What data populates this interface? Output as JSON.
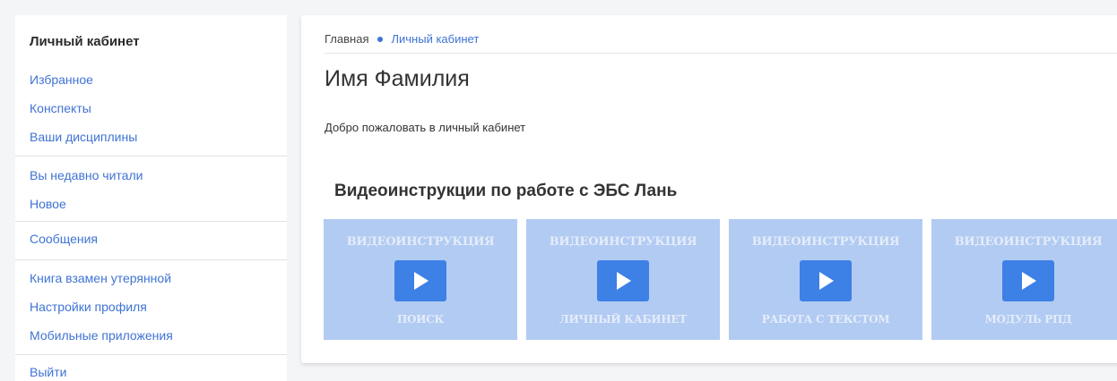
{
  "sidebar": {
    "title": "Личный кабинет",
    "groups": [
      {
        "items": [
          {
            "label": "Избранное"
          },
          {
            "label": "Конспекты"
          },
          {
            "label": "Ваши дисциплины"
          }
        ]
      },
      {
        "items": [
          {
            "label": "Вы недавно читали"
          },
          {
            "label": "Новое"
          }
        ]
      },
      {
        "items": [
          {
            "label": "Сообщения"
          }
        ]
      },
      {
        "items": [
          {
            "label": "Книга взамен утерянной"
          },
          {
            "label": "Настройки профиля"
          },
          {
            "label": "Мобильные приложения"
          }
        ]
      },
      {
        "items": [
          {
            "label": "Выйти"
          }
        ]
      }
    ]
  },
  "breadcrumb": {
    "home": "Главная",
    "current": "Личный кабинет"
  },
  "page": {
    "title": "Имя Фамилия",
    "welcome": "Добро пожаловать в личный кабинет",
    "section_title": "Видеоинструкции по работе с ЭБС Лань"
  },
  "videos": [
    {
      "top": "ВИДЕОИНСТРУКЦИЯ",
      "bottom": "ПОИСК",
      "icon": "play-icon"
    },
    {
      "top": "ВИДЕОИНСТРУКЦИЯ",
      "bottom": "ЛИЧНЫЙ КАБИНЕТ",
      "icon": "play-icon"
    },
    {
      "top": "ВИДЕОИНСТРУКЦИЯ",
      "bottom": "РАБОТА С ТЕКСТОМ",
      "icon": "play-icon"
    },
    {
      "top": "ВИДЕОИНСТРУКЦИЯ",
      "bottom": "МОДУЛЬ РПД",
      "icon": "play-icon"
    }
  ],
  "colors": {
    "accent": "#3f73d4",
    "card_bg": "#b2cbf2",
    "play_button": "#3d80e6",
    "page_bg": "#f4f5f7"
  }
}
